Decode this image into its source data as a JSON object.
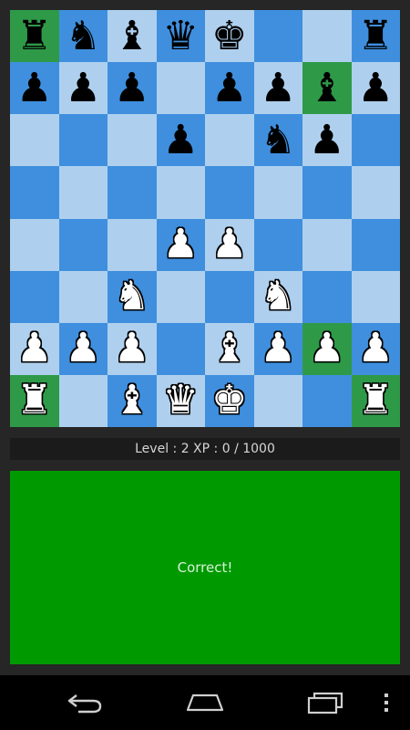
{
  "board": {
    "colors": {
      "light": "#aed0ee",
      "dark": "#3f8fde",
      "highlight": "#2e9a48"
    },
    "highlighted": [
      "a8",
      "g7",
      "g2",
      "a1",
      "h1"
    ],
    "ranks": [
      [
        "r",
        "n",
        "b",
        "q",
        "k",
        "",
        "",
        "r"
      ],
      [
        "p",
        "p",
        "p",
        "",
        "p",
        "p",
        "b",
        "p"
      ],
      [
        "",
        "",
        "",
        "p",
        "",
        "n",
        "p",
        ""
      ],
      [
        "",
        "",
        "",
        "",
        "",
        "",
        "",
        ""
      ],
      [
        "",
        "",
        "",
        "P",
        "P",
        "",
        "",
        ""
      ],
      [
        "",
        "",
        "N",
        "",
        "",
        "N",
        "",
        ""
      ],
      [
        "P",
        "P",
        "P",
        "",
        "B",
        "P",
        "P",
        "P"
      ],
      [
        "R",
        "",
        "B",
        "Q",
        "K",
        "",
        "",
        "R"
      ]
    ],
    "glyphs": {
      "k": "♚",
      "q": "♛",
      "r": "♜",
      "b": "♝",
      "n": "♞",
      "p": "♟",
      "K": "♚",
      "Q": "♛",
      "R": "♜",
      "B": "♝",
      "N": "♞",
      "P": "♟"
    }
  },
  "status": {
    "level_text": "Level : 2 XP : 0 / 1000"
  },
  "result": {
    "message": "Correct!",
    "color": "#009a00"
  },
  "navbar": {
    "buttons": [
      {
        "name": "back-icon"
      },
      {
        "name": "home-icon"
      },
      {
        "name": "recent-apps-icon"
      },
      {
        "name": "menu-icon"
      }
    ]
  }
}
